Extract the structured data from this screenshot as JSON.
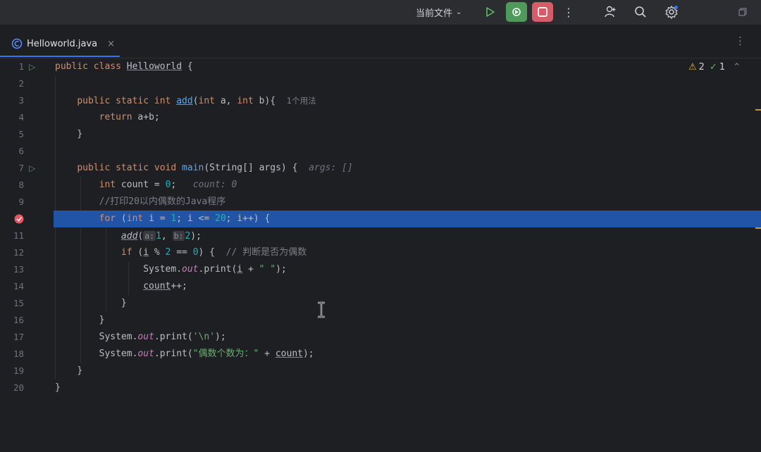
{
  "toolbar": {
    "run_config": "当前文件",
    "icons": [
      "play-icon",
      "debug-icon",
      "stop-icon",
      "more-icon",
      "add-user-icon",
      "search-icon",
      "settings-icon",
      "restore-window-icon"
    ]
  },
  "tab": {
    "label": "Helloworld.java",
    "close": "×",
    "menu": "⋮"
  },
  "inspection": {
    "warnings": "2",
    "checks": "1"
  },
  "gutter": {
    "line_numbers": [
      "1",
      "2",
      "3",
      "4",
      "5",
      "6",
      "7",
      "8",
      "9",
      "10",
      "11",
      "12",
      "13",
      "14",
      "15",
      "16",
      "17",
      "18",
      "19",
      "20"
    ]
  },
  "code": {
    "l1_kw1": "public",
    "l1_kw2": "class",
    "l1_name": "Helloworld",
    "l1_rest": " {",
    "l3_kw": "public static int ",
    "l3_fn": "add",
    "l3_a": "(",
    "l3_int1": "int",
    "l3_b": " a, ",
    "l3_int2": "int",
    "l3_c": " b){",
    "l3_hint": "1个用法",
    "l4_kw": "return",
    "l4_rest": " a+b;",
    "l5": "}",
    "l7_kw": "public static void ",
    "l7_fn": "main",
    "l7_rest": "(String[] args) {",
    "l7_hint": "args: []",
    "l8_kw": "int",
    "l8_a": " count = ",
    "l8_num": "0",
    "l8_b": ";",
    "l8_hint": "count: 0",
    "l9_comment": "//打印20以内偶数的Java程序",
    "l10_kw": "for",
    "l10_a": " (",
    "l10_int": "int",
    "l10_b": " i = ",
    "l10_n1": "1",
    "l10_c": "; i <= ",
    "l10_n2": "20",
    "l10_d": "; i++) {",
    "l11_fn": "add",
    "l11_a": "(",
    "l11_ha": "a:",
    "l11_n1": "1",
    "l11_comma": ", ",
    "l11_hb": "b:",
    "l11_n2": "2",
    "l11_end": ");",
    "l12_kw": "if",
    "l12_a": " (",
    "l12_i": "i",
    "l12_b": " % ",
    "l12_n2": "2",
    "l12_c": " == ",
    "l12_n0": "0",
    "l12_d": ") {",
    "l12_comment": "// 判断是否为偶数",
    "l13_a": "System.",
    "l13_out": "out",
    "l13_b": ".print(",
    "l13_i": "i",
    "l13_c": " + ",
    "l13_str": "\" \"",
    "l13_d": ");",
    "l14_count": "count",
    "l14_rest": "++;",
    "l15": "}",
    "l16": "}",
    "l17_a": "System.",
    "l17_out": "out",
    "l17_b": ".print(",
    "l17_str": "'\\n'",
    "l17_c": ");",
    "l18_a": "System.",
    "l18_out": "out",
    "l18_b": ".print(",
    "l18_str": "\"偶数个数为：\"",
    "l18_c": " + ",
    "l18_count": "count",
    "l18_d": ");",
    "l19": "}",
    "l20": "}"
  },
  "colors": {
    "keyword": "#cf8e6d",
    "function": "#56a8f5",
    "number": "#2aacb8",
    "string": "#6aab73",
    "highlight": "#2154a6",
    "breakpoint": "#e55765"
  }
}
